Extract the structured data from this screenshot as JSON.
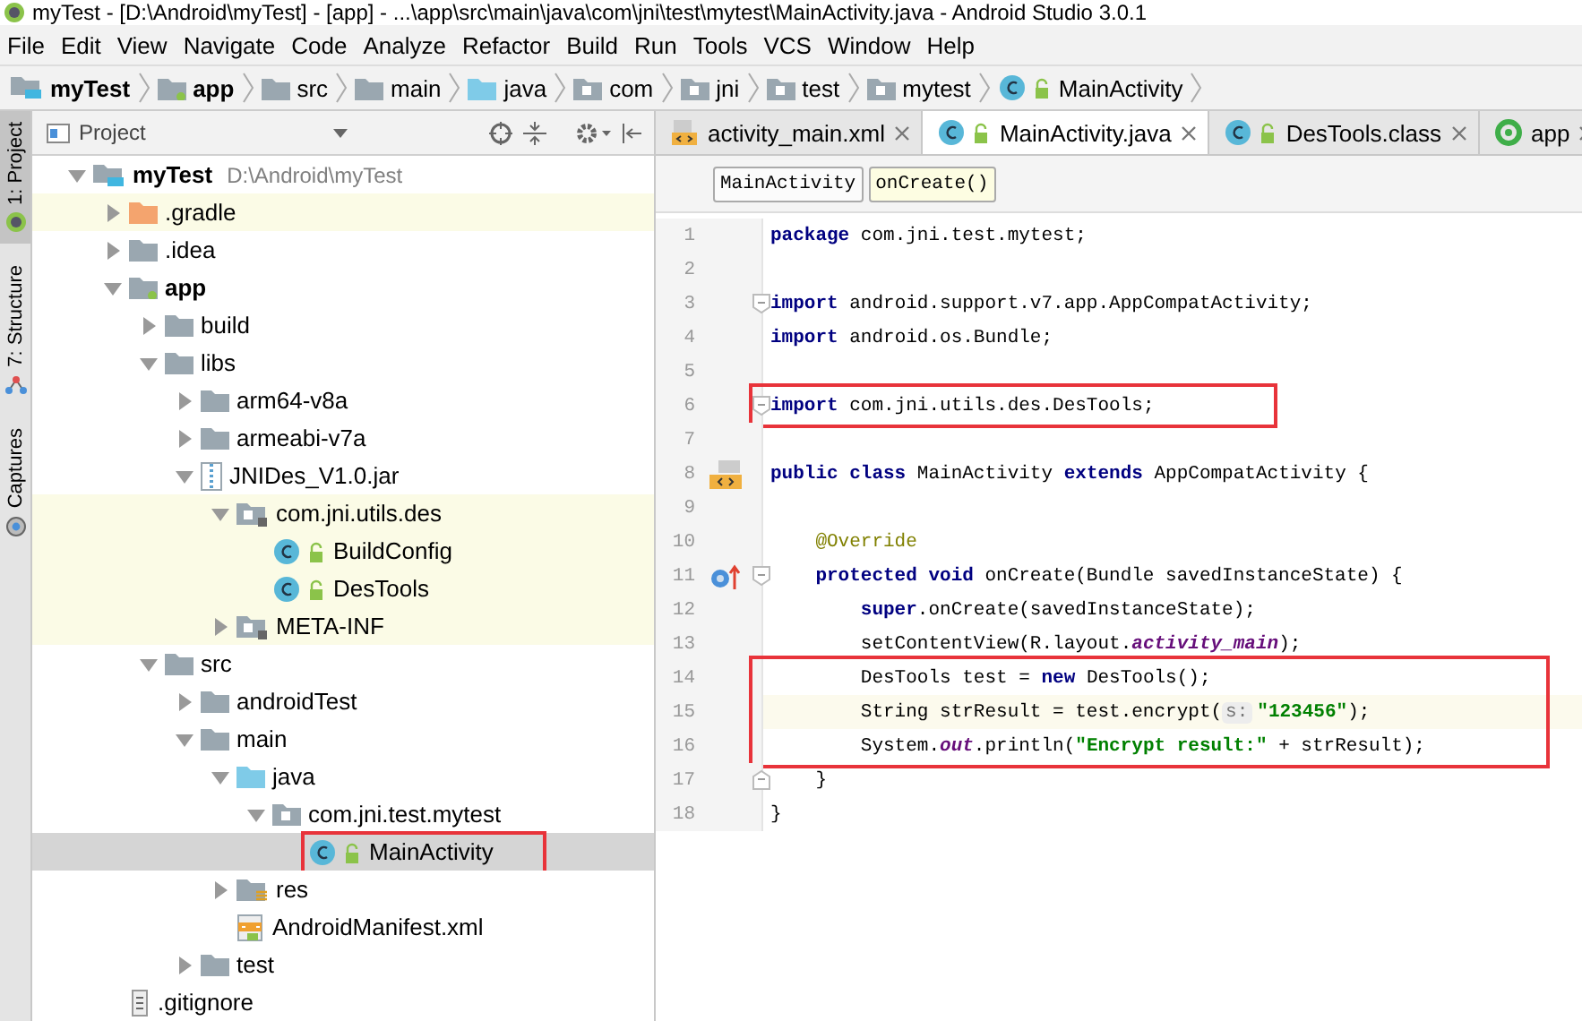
{
  "window": {
    "title": "myTest - [D:\\Android\\myTest] - [app] - ...\\app\\src\\main\\java\\com\\jni\\test\\mytest\\MainActivity.java - Android Studio 3.0.1"
  },
  "menu": [
    "File",
    "Edit",
    "View",
    "Navigate",
    "Code",
    "Analyze",
    "Refactor",
    "Build",
    "Run",
    "Tools",
    "VCS",
    "Window",
    "Help"
  ],
  "breadcrumb": [
    {
      "label": "myTest",
      "kind": "project",
      "bold": true
    },
    {
      "label": "app",
      "kind": "module",
      "bold": true
    },
    {
      "label": "src",
      "kind": "folder",
      "bold": false
    },
    {
      "label": "main",
      "kind": "folder",
      "bold": false
    },
    {
      "label": "java",
      "kind": "java-folder",
      "bold": false
    },
    {
      "label": "com",
      "kind": "package",
      "bold": false
    },
    {
      "label": "jni",
      "kind": "package",
      "bold": false
    },
    {
      "label": "test",
      "kind": "package",
      "bold": false
    },
    {
      "label": "mytest",
      "kind": "package",
      "bold": false
    },
    {
      "label": "MainActivity",
      "kind": "class",
      "bold": false
    }
  ],
  "tool_strip": [
    {
      "label": "1: Project",
      "kind": "android",
      "selected": true
    },
    {
      "label": "7: Structure",
      "kind": "structure",
      "selected": false
    },
    {
      "label": "Captures",
      "kind": "captures",
      "selected": false
    }
  ],
  "project_panel": {
    "title": "Project",
    "tree": [
      {
        "label": "myTest",
        "path": "D:\\Android\\myTest",
        "kind": "project",
        "bold": true,
        "expanded": true,
        "children": [
          {
            "label": ".gradle",
            "kind": "gradle-folder",
            "expanded": false,
            "library": true
          },
          {
            "label": ".idea",
            "kind": "folder",
            "expanded": false
          },
          {
            "label": "app",
            "kind": "module",
            "bold": true,
            "expanded": true,
            "children": [
              {
                "label": "build",
                "kind": "folder",
                "expanded": false
              },
              {
                "label": "libs",
                "kind": "folder",
                "expanded": true,
                "children": [
                  {
                    "label": "arm64-v8a",
                    "kind": "folder",
                    "expanded": false
                  },
                  {
                    "label": "armeabi-v7a",
                    "kind": "folder",
                    "expanded": false
                  },
                  {
                    "label": "JNIDes_V1.0.jar",
                    "kind": "jar",
                    "expanded": true,
                    "children": [
                      {
                        "label": "com.jni.utils.des",
                        "kind": "lib-package",
                        "expanded": true,
                        "library": true,
                        "children": [
                          {
                            "label": "BuildConfig",
                            "kind": "lib-class",
                            "library": true
                          },
                          {
                            "label": "DesTools",
                            "kind": "lib-class",
                            "library": true
                          }
                        ]
                      },
                      {
                        "label": "META-INF",
                        "kind": "lib-package",
                        "expanded": false,
                        "library": true
                      }
                    ]
                  }
                ]
              },
              {
                "label": "src",
                "kind": "folder",
                "expanded": true,
                "children": [
                  {
                    "label": "androidTest",
                    "kind": "folder",
                    "expanded": false
                  },
                  {
                    "label": "main",
                    "kind": "folder",
                    "expanded": true,
                    "children": [
                      {
                        "label": "java",
                        "kind": "java-folder",
                        "expanded": true,
                        "children": [
                          {
                            "label": "com.jni.test.mytest",
                            "kind": "package",
                            "expanded": true,
                            "children": [
                              {
                                "label": "MainActivity",
                                "kind": "class",
                                "selected": true,
                                "boxed": true
                              }
                            ]
                          }
                        ]
                      },
                      {
                        "label": "res",
                        "kind": "res-folder",
                        "expanded": false
                      },
                      {
                        "label": "AndroidManifest.xml",
                        "kind": "manifest"
                      }
                    ]
                  },
                  {
                    "label": "test",
                    "kind": "folder",
                    "expanded": false
                  }
                ]
              }
            ]
          },
          {
            "label": ".gitignore",
            "kind": "text-file"
          }
        ]
      }
    ]
  },
  "editor": {
    "tabs": [
      {
        "label": "activity_main.xml",
        "kind": "xml",
        "selected": false
      },
      {
        "label": "MainActivity.java",
        "kind": "class",
        "selected": true
      },
      {
        "label": "DesTools.class",
        "kind": "lib-class",
        "selected": false
      },
      {
        "label": "app",
        "kind": "run-config",
        "selected": false
      }
    ],
    "crumbs": [
      {
        "label": "MainActivity",
        "selected": false
      },
      {
        "label": "onCreate()",
        "selected": true
      }
    ],
    "lines": [
      {
        "number": "1",
        "segments": [
          {
            "kind": "keyword",
            "text": "package"
          },
          {
            "kind": "plain",
            "text": " com.jni.test.mytest;"
          }
        ]
      },
      {
        "number": "2"
      },
      {
        "number": "3",
        "fold": {
          "kind": "start"
        },
        "segments": [
          {
            "kind": "keyword",
            "text": "import"
          },
          {
            "kind": "plain",
            "text": " android.support.v7.app.AppCompatActivity;"
          }
        ]
      },
      {
        "number": "4",
        "segments": [
          {
            "kind": "keyword",
            "text": "import"
          },
          {
            "kind": "plain",
            "text": " android.os.Bundle;"
          }
        ]
      },
      {
        "number": "5"
      },
      {
        "number": "6",
        "fold": {
          "kind": "start"
        },
        "boxed": true,
        "segments": [
          {
            "kind": "keyword",
            "text": "import"
          },
          {
            "kind": "plain",
            "text": " com.jni.utils.des.DesTools;"
          }
        ]
      },
      {
        "number": "7"
      },
      {
        "number": "8",
        "gutter_icon": {
          "kind": "layout"
        },
        "segments": [
          {
            "kind": "keyword",
            "text": "public class"
          },
          {
            "kind": "plain",
            "text": " MainActivity "
          },
          {
            "kind": "keyword",
            "text": "extends"
          },
          {
            "kind": "plain",
            "text": " AppCompatActivity {"
          }
        ]
      },
      {
        "number": "9"
      },
      {
        "number": "10",
        "segments": [
          {
            "kind": "annotation",
            "text": "    @Override"
          }
        ]
      },
      {
        "number": "11",
        "gutter_icon": {
          "kind": "override"
        },
        "fold": {
          "kind": "start"
        },
        "segments": [
          {
            "kind": "keyword",
            "text": "    protected void"
          },
          {
            "kind": "plain",
            "text": " onCreate(Bundle savedInstanceState) {"
          }
        ]
      },
      {
        "number": "12",
        "segments": [
          {
            "kind": "keyword",
            "text": "        super"
          },
          {
            "kind": "plain",
            "text": ".onCreate(savedInstanceState);"
          }
        ]
      },
      {
        "number": "13",
        "segments": [
          {
            "kind": "plain",
            "text": "        setContentView(R.layout."
          },
          {
            "kind": "field",
            "text": "activity_main"
          },
          {
            "kind": "plain",
            "text": ");"
          }
        ]
      },
      {
        "number": "14",
        "boxed": true,
        "segments": [
          {
            "kind": "plain",
            "text": "        DesTools test = "
          },
          {
            "kind": "keyword",
            "text": "new"
          },
          {
            "kind": "plain",
            "text": " DesTools();"
          }
        ]
      },
      {
        "number": "15",
        "boxed": true,
        "current": true,
        "segments": [
          {
            "kind": "plain",
            "text": "        String strResult = test.encrypt("
          },
          {
            "kind": "hint",
            "text": "s:"
          },
          {
            "kind": "string",
            "text": "\"123456\""
          },
          {
            "kind": "plain",
            "text": ");"
          }
        ]
      },
      {
        "number": "16",
        "boxed": true,
        "segments": [
          {
            "kind": "plain",
            "text": "        System."
          },
          {
            "kind": "field",
            "text": "out"
          },
          {
            "kind": "plain",
            "text": ".println("
          },
          {
            "kind": "string",
            "text": "\"Encrypt result:\""
          },
          {
            "kind": "plain",
            "text": " + strResult);"
          }
        ]
      },
      {
        "number": "17",
        "fold": {
          "kind": "end"
        },
        "segments": [
          {
            "kind": "plain",
            "text": "    }"
          }
        ]
      },
      {
        "number": "18",
        "segments": [
          {
            "kind": "plain",
            "text": "}"
          }
        ]
      }
    ]
  }
}
